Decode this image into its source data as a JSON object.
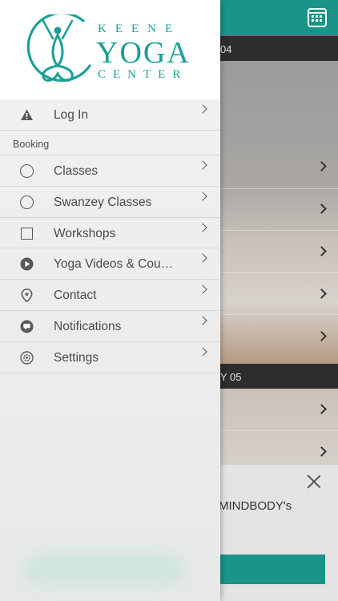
{
  "drawer": {
    "logo": {
      "line1": "KEENE",
      "line2": "YOGA",
      "line3": "CENTER"
    },
    "items_top": [
      {
        "label": "Log In",
        "icon": "warning-icon"
      }
    ],
    "section_booking": "Booking",
    "items": [
      {
        "label": "Classes",
        "icon": "circle-icon"
      },
      {
        "label": "Swanzey Classes",
        "icon": "circle-icon"
      },
      {
        "label": "Workshops",
        "icon": "square-icon"
      },
      {
        "label": "Yoga Videos & Cou…",
        "icon": "play-icon"
      },
      {
        "label": "Contact",
        "icon": "location-pin-icon"
      },
      {
        "label": "Notifications",
        "icon": "chat-bubble-icon"
      },
      {
        "label": "Settings",
        "icon": "gear-icon"
      }
    ]
  },
  "background": {
    "day_header_1": "04",
    "day_header_2": "Y 05",
    "dialog_text": "MINDBODY's"
  },
  "colors": {
    "brand": "#1a9489",
    "logo": "#1aa098"
  }
}
